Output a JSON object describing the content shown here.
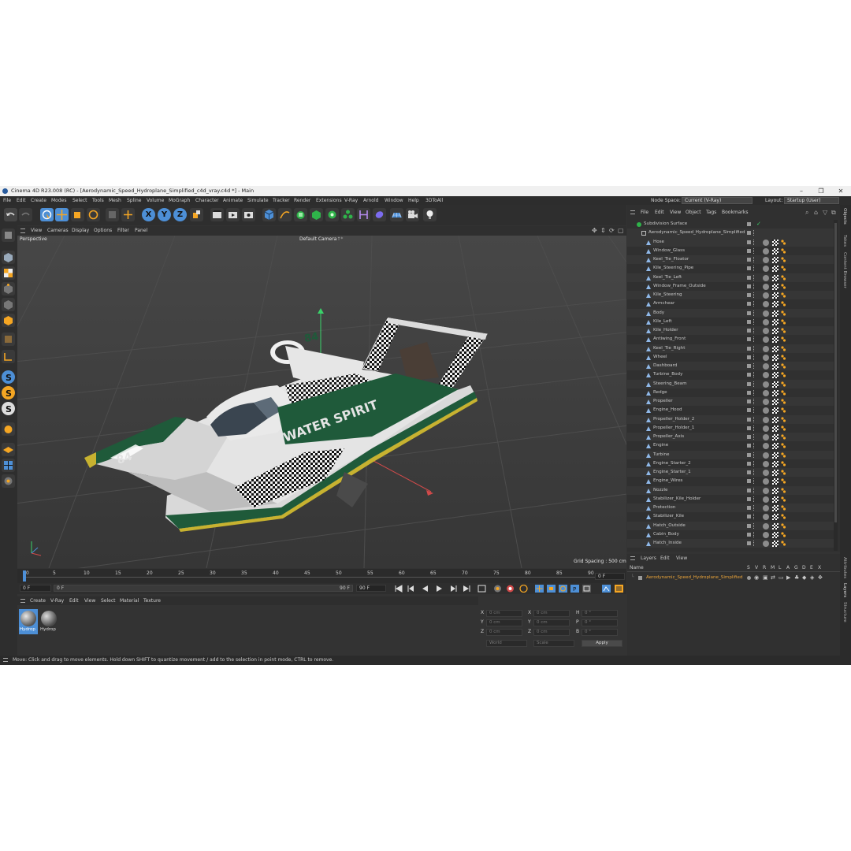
{
  "window": {
    "title": "Cinema 4D R23.008 (RC) - [Aerodynamic_Speed_Hydroplane_Simplified_c4d_vray.c4d *] - Main",
    "minimize": "–",
    "maximize": "❐",
    "close": "✕"
  },
  "menubar": {
    "items": [
      "File",
      "Edit",
      "Create",
      "Modes",
      "Select",
      "Tools",
      "Mesh",
      "Spline",
      "Volume",
      "MoGraph",
      "Character",
      "Animate",
      "Simulate",
      "Tracker",
      "Render",
      "Extensions",
      "V-Ray",
      "Arnold",
      "Window",
      "Help",
      "3DToAll"
    ],
    "node_space_label": "Node Space:",
    "node_space_value": "Current (V-Ray)",
    "layout_label": "Layout:",
    "layout_value": "Startup (User)"
  },
  "toolbar": {
    "axis_x": "X",
    "axis_y": "Y",
    "axis_z": "Z"
  },
  "viewport": {
    "menu": [
      "View",
      "Cameras",
      "Display",
      "Options",
      "Filter",
      "Panel"
    ],
    "projection": "Perspective",
    "camera": "Default Camera",
    "grid_spacing": "Grid Spacing : 500 cm",
    "model_number": "84",
    "model_text": "WATER SPIRIT"
  },
  "timeline": {
    "ticks": [
      "0",
      "5",
      "10",
      "15",
      "20",
      "25",
      "30",
      "35",
      "40",
      "45",
      "50",
      "55",
      "60",
      "65",
      "70",
      "75",
      "80",
      "85",
      "90"
    ],
    "current_frame_right": "0 F",
    "start_frame": "0 F",
    "start_frame_2": "0 F",
    "end_frame": "90 F",
    "end_frame_2": "90 F"
  },
  "materials": {
    "menu": [
      "Create",
      "V-Ray",
      "Edit",
      "View",
      "Select",
      "Material",
      "Texture"
    ],
    "items": [
      {
        "label": "Hydrop"
      },
      {
        "label": "Hydrop"
      }
    ]
  },
  "coordinates": {
    "x_label": "X",
    "y_label": "Y",
    "z_label": "Z",
    "h_label": "H",
    "p_label": "P",
    "b_label": "B",
    "pos_x": "0 cm",
    "pos_y": "0 cm",
    "pos_z": "0 cm",
    "size_x": "0 cm",
    "size_y": "0 cm",
    "size_z": "0 cm",
    "rot_h": "0 °",
    "rot_p": "0 °",
    "rot_b": "0 °",
    "mode_world": "World",
    "mode_scale": "Scale",
    "apply": "Apply"
  },
  "objects": {
    "menu": [
      "File",
      "Edit",
      "View",
      "Object",
      "Tags",
      "Bookmarks"
    ],
    "root": "Subdivision Surface",
    "group": "Aerodynamic_Speed_Hydroplane_Simplified",
    "items": [
      "Hose",
      "Window_Glass",
      "Keel_Tie_Floator",
      "Kile_Steering_Pipe",
      "Keel_Tie_Left",
      "Window_Frame_Outside",
      "Kile_Steering",
      "Armchear",
      "Body",
      "Kile_Left",
      "Kile_Holder",
      "Antiwing_Front",
      "Keel_Tie_Right",
      "Wheel",
      "Dashboard",
      "Turbine_Body",
      "Steering_Beam",
      "Redge",
      "Propeller",
      "Engine_Hood",
      "Propeller_Holder_2",
      "Propeller_Holder_1",
      "Propeller_Axis",
      "Engine",
      "Turbine",
      "Engine_Starter_2",
      "Engine_Starter_1",
      "Engine_Wires",
      "Nozzle",
      "Stabilizer_Kile_Holder",
      "Protection",
      "Stabilizer_Kile",
      "Hatch_Outside",
      "Cabin_Body",
      "Hatch_Inside"
    ]
  },
  "layers": {
    "menu": [
      "Layers",
      "Edit",
      "View"
    ],
    "name_header": "Name",
    "columns": [
      "S",
      "V",
      "R",
      "M",
      "L",
      "A",
      "G",
      "D",
      "E",
      "X"
    ],
    "layer_name": "Aerodynamic_Speed_Hydroplane_Simplified",
    "layer_color": "#e8a33a"
  },
  "side_tabs": [
    "Objects",
    "Takes",
    "Content Browser",
    "Attributes",
    "Layers",
    "Structure"
  ],
  "status": {
    "message": "Move: Click and drag to move elements. Hold down SHIFT to quantize movement / add to the selection in point mode, CTRL to remove."
  },
  "colors": {
    "accent_blue": "#4d8fd6",
    "hull_green": "#1f5a3a",
    "hull_white": "#d9d9d9",
    "axis_green": "#3ad36a",
    "axis_red": "#d24a4a"
  }
}
